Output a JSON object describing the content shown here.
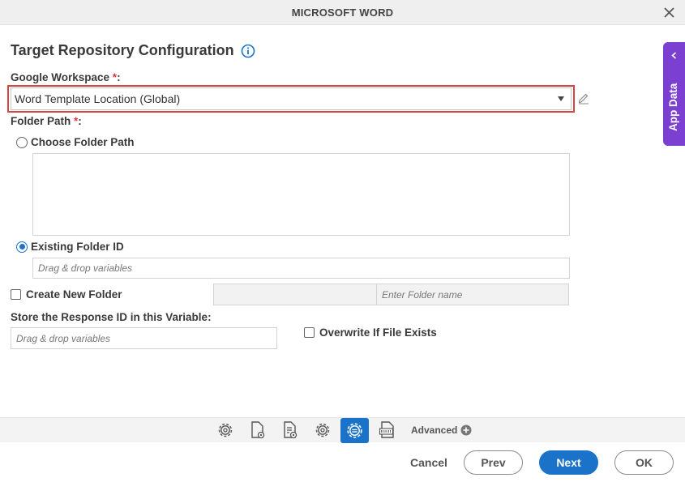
{
  "window": {
    "title": "MICROSOFT WORD"
  },
  "form": {
    "heading": "Target Repository Configuration",
    "workspace": {
      "label": "Google Workspace ",
      "required_mark": "*",
      "colon": ":",
      "value": "Word Template Location (Global)"
    },
    "folder_path": {
      "label": "Folder Path ",
      "required_mark": "*",
      "colon": ":"
    },
    "choose_folder_path": {
      "label": "Choose Folder Path",
      "selected": false
    },
    "existing_folder_id": {
      "label": "Existing Folder ID",
      "selected": true,
      "placeholder": "Drag & drop variables"
    },
    "create_new_folder": {
      "label": "Create New Folder",
      "checked": false,
      "folder_name_placeholder": "Enter Folder name"
    },
    "response_id": {
      "label": "Store the Response ID in this Variable:",
      "placeholder": "Drag & drop variables"
    },
    "overwrite": {
      "label": "Overwrite If File Exists",
      "checked": false
    }
  },
  "side_panel": {
    "label": "App Data"
  },
  "toolbar": {
    "icons": [
      "gear-icon",
      "document-settings-icon",
      "list-settings-icon",
      "gear-icon",
      "active-settings-icon",
      "doc-file-icon"
    ],
    "advanced_label": "Advanced"
  },
  "buttons": {
    "cancel": "Cancel",
    "prev": "Prev",
    "next": "Next",
    "ok": "OK"
  },
  "colors": {
    "accent": "#1a73c9",
    "purple": "#7b3fd1",
    "highlight_border": "#d64541",
    "required": "#d9363e"
  }
}
